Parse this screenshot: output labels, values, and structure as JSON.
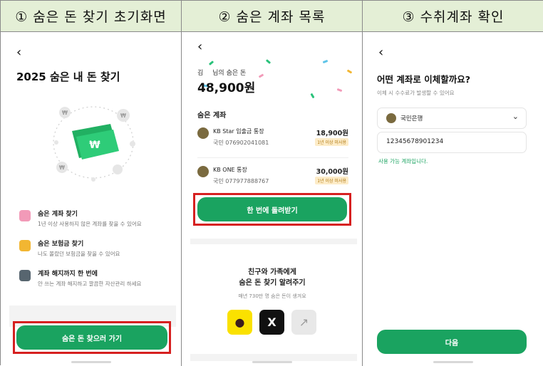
{
  "headers": [
    "① 숨은 돈 찾기 초기화면",
    "② 숨은 계좌 목록",
    "③ 수취계좌 확인"
  ],
  "back_icon": "chevron-left-icon",
  "screen1": {
    "title": "2025 숨은 내 돈 찾기",
    "features": [
      {
        "title": "숨은 계좌 찾기",
        "desc": "1년 이상 사용하지 않은 계좌를 찾을 수 있어요",
        "icon": "piggy-bank-icon",
        "color": "#f29ab8"
      },
      {
        "title": "숨은 보험금 찾기",
        "desc": "나도 몰랐던 보험금을 찾을 수 있어요",
        "icon": "money-bag-icon",
        "color": "#f2b632"
      },
      {
        "title": "계좌 해지까지 한 번에",
        "desc": "안 쓰는 계좌 해지하고 깔끔한 자산관리 하세요",
        "icon": "card-icon",
        "color": "#57656f"
      }
    ],
    "button": "숨은 돈 찾으러 가기"
  },
  "screen2": {
    "owner_initial": "김",
    "owner_label": "님의 숨은 돈",
    "total": "48,900원",
    "section_title": "숨은 계좌",
    "accounts": [
      {
        "name": "KB Star 입출금 통장",
        "number": "국민 076902041081",
        "amount": "18,900원",
        "tag": "1년 이상 미사용"
      },
      {
        "name": "KB ONE 통장",
        "number": "국민 077977888767",
        "amount": "30,000원",
        "tag": "1년 이상 미사용"
      }
    ],
    "button": "한 번에 돌려받기",
    "share_title_1": "친구와 가족에게",
    "share_title_2": "숨은 돈 찾기 알려주기",
    "share_sub": "매년 730만 명 숨은 돈이 생겨요",
    "share_icons": [
      "kakaotalk-icon",
      "x-icon",
      "share-link-icon"
    ]
  },
  "screen3": {
    "title": "어떤 계좌로 이체할까요?",
    "subtitle": "이체 시 수수료가 발생할 수 있어요",
    "bank": "국민은행",
    "account_number": "12345678901234",
    "valid_msg": "사용 가능 계좌입니다.",
    "button": "다음"
  },
  "colors": {
    "accent": "#1aa360",
    "highlight": "#d62020",
    "header_bg": "#e4efd6"
  }
}
